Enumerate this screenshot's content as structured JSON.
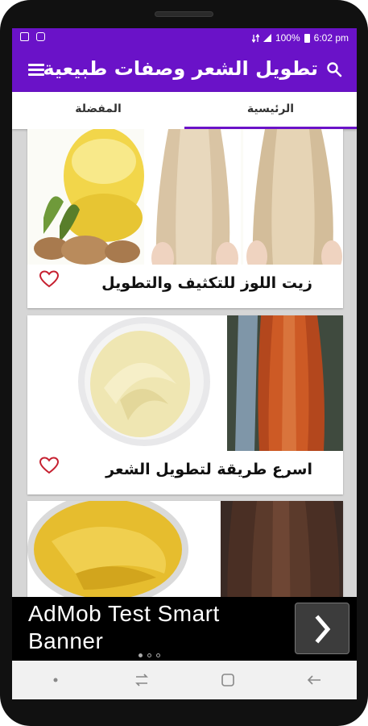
{
  "status_bar": {
    "battery": "100%",
    "time": "6:02 pm"
  },
  "app_bar": {
    "title": "تطويل الشعر وصفات طبيعية"
  },
  "tabs": [
    {
      "label": "المفضلة",
      "active": false
    },
    {
      "label": "الرئيسية",
      "active": true
    }
  ],
  "cards": [
    {
      "caption": "زيت اللوز للتكثيف والتطويل",
      "image": "almond-oil-and-long-blonde-hair",
      "favorited": false
    },
    {
      "caption": "اسرع طريقة لتطويل الشعر",
      "image": "cream-bowl-and-long-red-hair",
      "favorited": false
    },
    {
      "caption": "",
      "image": "yellow-mask-and-long-brown-hair",
      "favorited": false
    }
  ],
  "ad_banner": {
    "text": "AdMob Test Smart Banner",
    "page_dots": 3,
    "active_dot": 0
  },
  "colors": {
    "primary": "#6a12c8",
    "heart": "#c62030"
  },
  "nav_bar": {
    "icons": [
      "dot-icon",
      "recents-icon",
      "home-icon",
      "back-icon"
    ]
  }
}
